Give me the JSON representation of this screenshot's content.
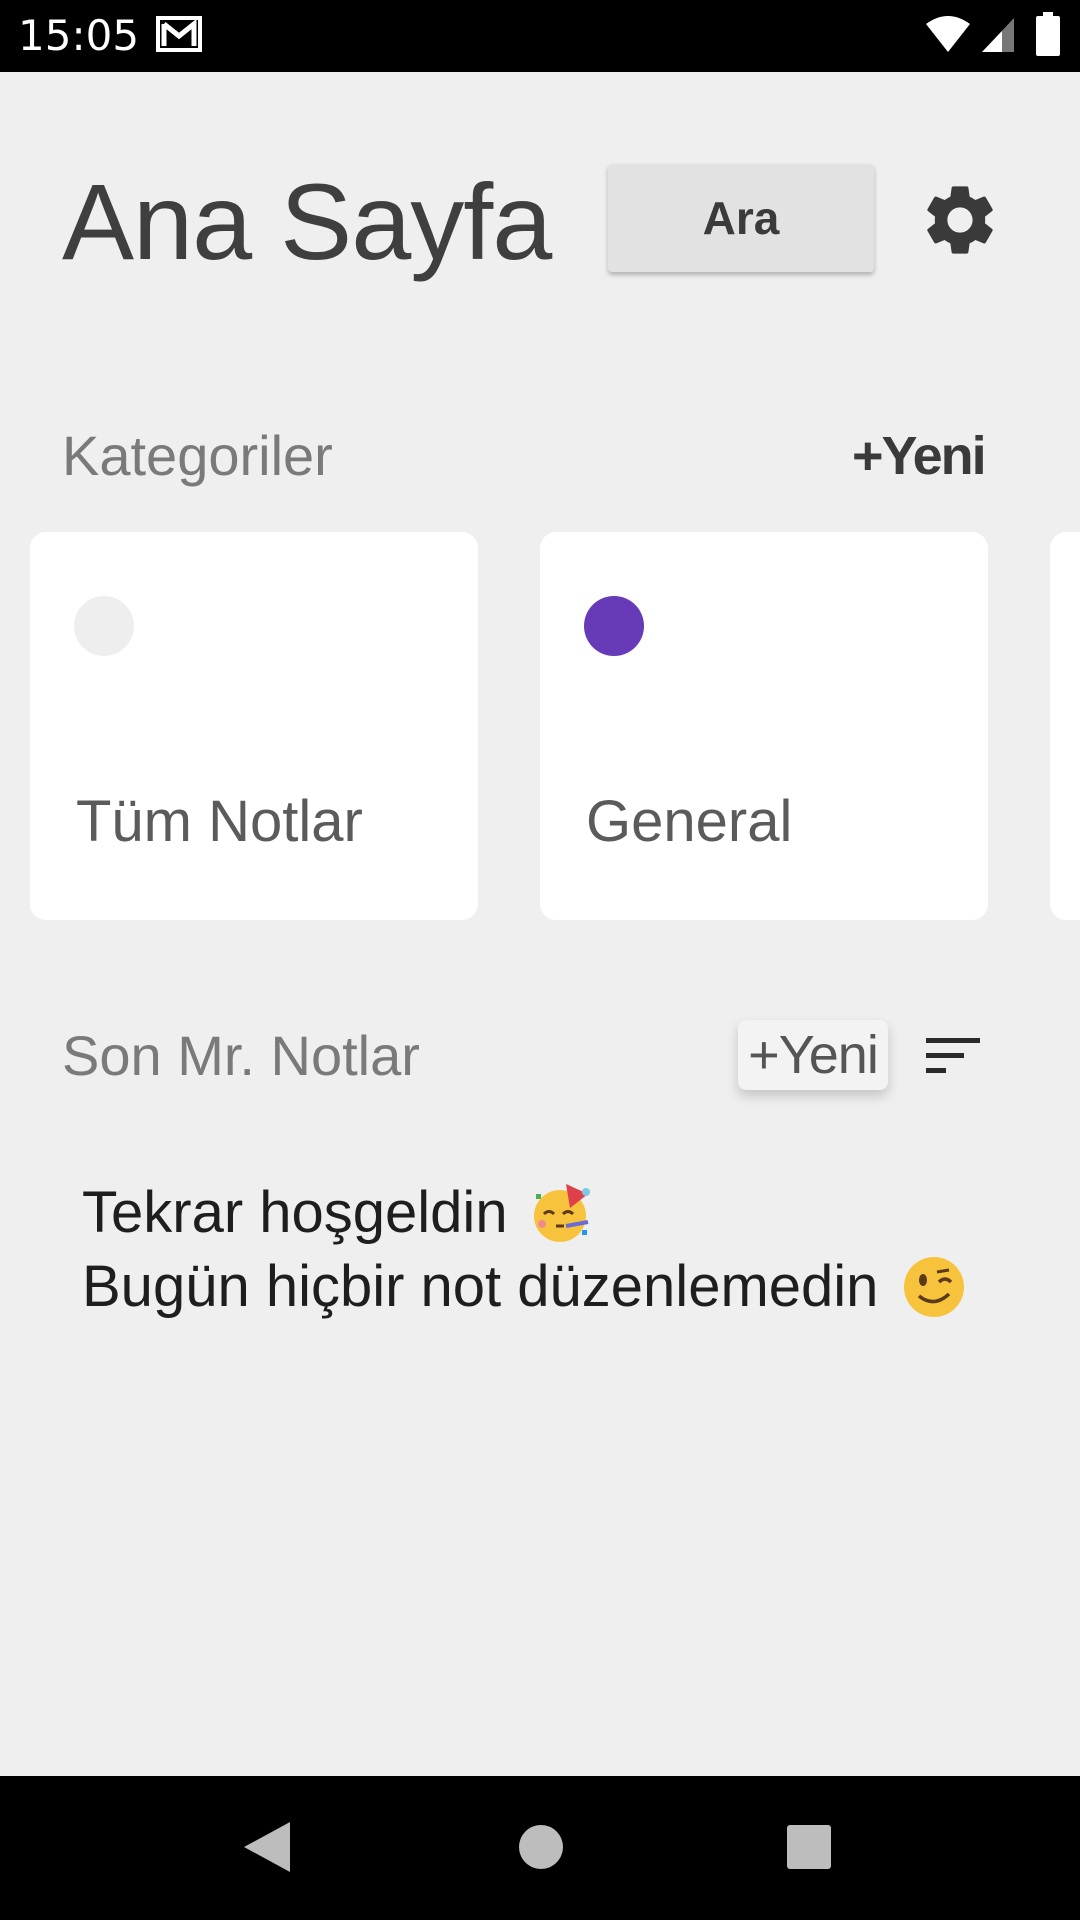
{
  "status_bar": {
    "time": "15:05",
    "icons": [
      "mail-icon",
      "wifi-icon",
      "signal-icon",
      "battery-icon"
    ]
  },
  "header": {
    "title": "Ana Sayfa",
    "search_label": "Ara",
    "settings_icon": "gear-icon"
  },
  "categories": {
    "label": "Kategoriler",
    "new_label": "+Yeni",
    "items": [
      {
        "label": "Tüm Notlar",
        "color": "#eeeeee"
      },
      {
        "label": "General",
        "color": "#673ab7"
      }
    ]
  },
  "recent": {
    "label": "Son Mr. Notlar",
    "new_label": "+Yeni",
    "sort_icon": "sort-icon"
  },
  "welcome": {
    "line1": "Tekrar hoşgeldin",
    "line1_emoji": "party-face-emoji",
    "line2": "Bugün hiçbir not düzenlemedin",
    "line2_emoji": "winking-face-emoji"
  },
  "nav_bar": {
    "icons": [
      "back-icon",
      "home-icon",
      "recents-icon"
    ]
  },
  "colors": {
    "background": "#efefef",
    "accent": "#673ab7"
  }
}
